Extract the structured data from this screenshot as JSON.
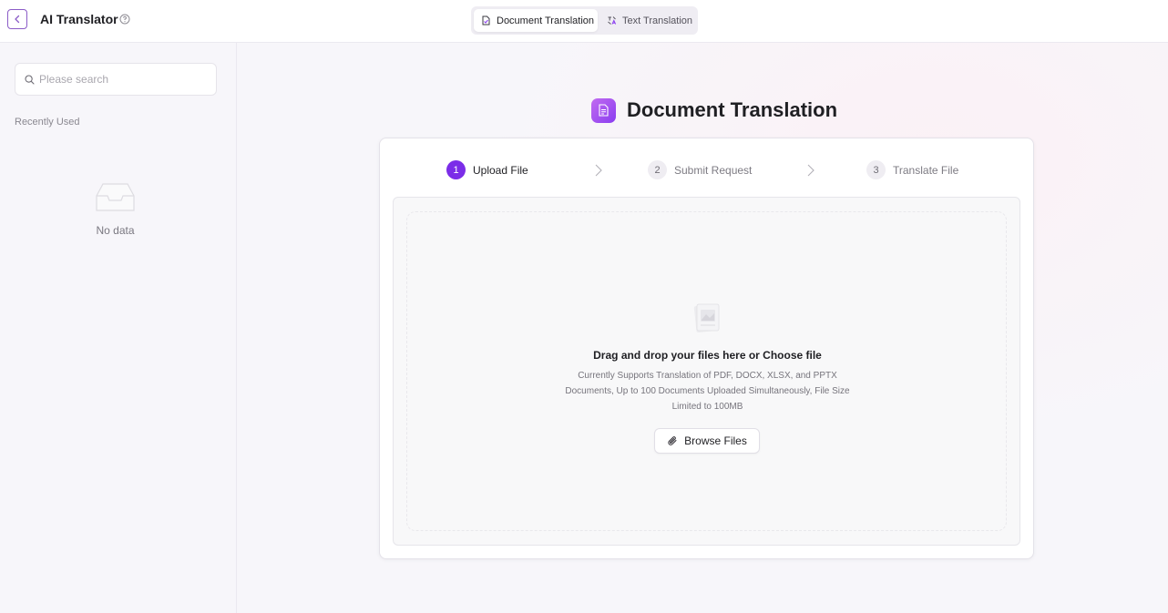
{
  "header": {
    "app_title": "AI Translator",
    "tabs": [
      {
        "label": "Document Translation",
        "active": true
      },
      {
        "label": "Text Translation",
        "active": false
      }
    ]
  },
  "sidebar": {
    "search": {
      "placeholder": "Please search",
      "value": ""
    },
    "recent_label": "Recently Used",
    "empty_text": "No data"
  },
  "main": {
    "heading": "Document Translation",
    "steps": [
      {
        "number": "1",
        "label": "Upload File",
        "active": true
      },
      {
        "number": "2",
        "label": "Submit Request",
        "active": false
      },
      {
        "number": "3",
        "label": "Translate File",
        "active": false
      }
    ],
    "dropzone": {
      "title": "Drag and drop your files here or Choose file",
      "description": "Currently Supports Translation of PDF, DOCX, XLSX, and PPTX Documents, Up to 100 Documents Uploaded Simultaneously, File Size Limited to 100MB",
      "browse_label": "Browse Files"
    }
  },
  "colors": {
    "accent": "#7b2de8",
    "accent_gradient_start": "#c16bf0",
    "back_border": "#8b5cc7"
  }
}
